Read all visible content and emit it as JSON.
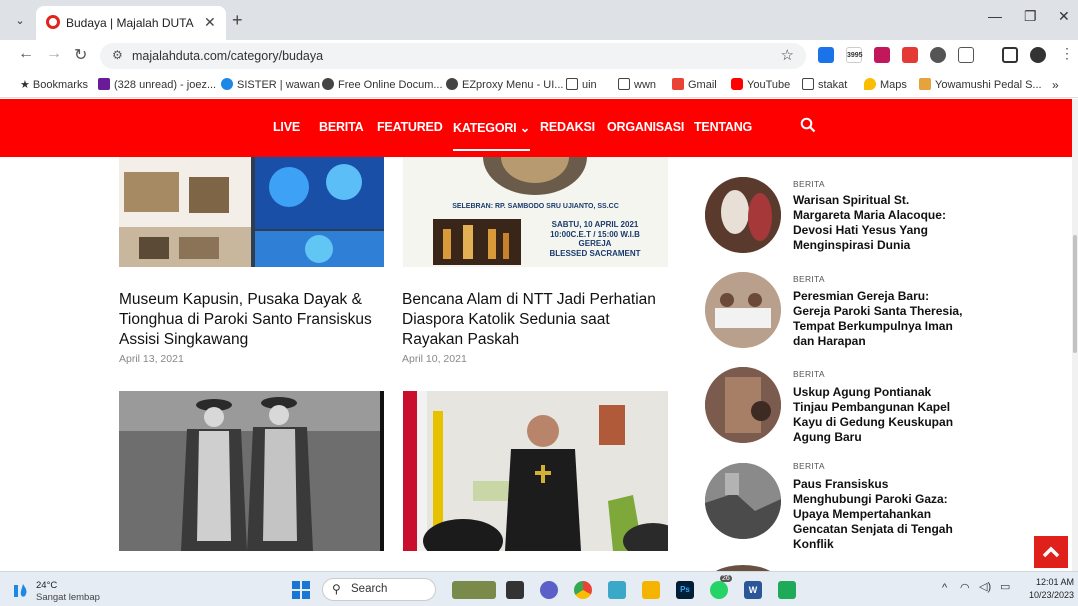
{
  "browser": {
    "tab_title": "Budaya | Majalah DUTA",
    "url": "majalahduta.com/category/budaya",
    "ext_badge": "3995",
    "bookmarks": [
      "Bookmarks",
      "(328 unread) - joez...",
      "SISTER | wawan",
      "Free Online Docum...",
      "EZproxy Menu - UI...",
      "uin",
      "wwn",
      "Gmail",
      "YouTube",
      "stakat",
      "Maps",
      "Yowamushi Pedal S..."
    ]
  },
  "site_nav": {
    "items": [
      "LIVE",
      "BERITA",
      "FEATURED",
      "KATEGORI ⌄",
      "REDAKSI",
      "ORGANISASI",
      "TENTANG"
    ]
  },
  "articles": [
    {
      "title": "Museum Kapusin, Pusaka Dayak & Tionghua di Paroki Santo Fransiskus Assisi Singkawang",
      "date": "April 13, 2021"
    },
    {
      "title": "Bencana Alam di NTT Jadi Perhatian Diaspora Katolik Sedunia saat Rayakan Paskah",
      "date": "April 10, 2021"
    }
  ],
  "poster": {
    "celebrant": "SELEBRAN: RP. SAMBODO SRU UJIANTO, SS.CC",
    "line1": "SABTU, 10 APRIL 2021",
    "line2": "10:00C.E.T  / 15:00 W.I.B",
    "line3": "GEREJA",
    "line4": "BLESSED SACRAMENT"
  },
  "sidebar": [
    {
      "category": "BERITA",
      "title": "Warisan Spiritual St. Margareta Maria Alacoque: Devosi Hati Yesus Yang Menginspirasi Dunia"
    },
    {
      "category": "BERITA",
      "title": "Peresmian Gereja Baru: Gereja Paroki Santa Theresia, Tempat Berkumpulnya Iman dan Harapan"
    },
    {
      "category": "BERITA",
      "title": "Uskup Agung Pontianak Tinjau Pembangunan Kapel Kayu di Gedung Keuskupan Agung Baru"
    },
    {
      "category": "BERITA",
      "title": "Paus Fransiskus Menghubungi Paroki Gaza: Upaya Mempertahankan Gencatan Senjata di Tengah Konflik"
    }
  ],
  "taskbar": {
    "temp": "24°C",
    "weather": "Sangat lembap",
    "search": "Search",
    "chat_badge": "26",
    "time": "12:01 AM",
    "date": "10/23/2023"
  }
}
